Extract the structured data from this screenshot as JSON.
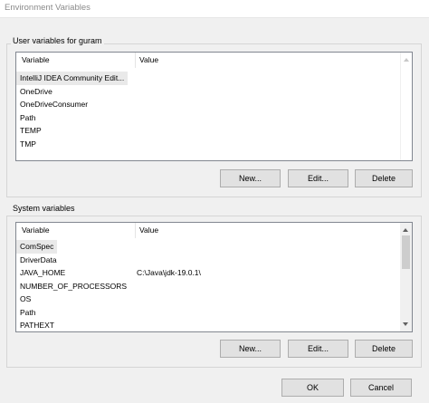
{
  "window": {
    "title": "Environment Variables"
  },
  "user_vars": {
    "group_label": "User variables for guram",
    "col_variable": "Variable",
    "col_value": "Value",
    "rows": [
      {
        "name": "IntelliJ IDEA Community Edit...",
        "value": ""
      },
      {
        "name": "OneDrive",
        "value": ""
      },
      {
        "name": "OneDriveConsumer",
        "value": ""
      },
      {
        "name": "Path",
        "value": ""
      },
      {
        "name": "TEMP",
        "value": ""
      },
      {
        "name": "TMP",
        "value": ""
      }
    ],
    "buttons": {
      "new": "New...",
      "edit": "Edit...",
      "delete": "Delete"
    }
  },
  "system_vars": {
    "group_label": "System variables",
    "col_variable": "Variable",
    "col_value": "Value",
    "rows": [
      {
        "name": "ComSpec",
        "value": ""
      },
      {
        "name": "DriverData",
        "value": ""
      },
      {
        "name": "JAVA_HOME",
        "value": "C:\\Java\\jdk-19.0.1\\"
      },
      {
        "name": "NUMBER_OF_PROCESSORS",
        "value": ""
      },
      {
        "name": "OS",
        "value": ""
      },
      {
        "name": "Path",
        "value": ""
      },
      {
        "name": "PATHEXT",
        "value": ""
      }
    ],
    "buttons": {
      "new": "New...",
      "edit": "Edit...",
      "delete": "Delete"
    }
  },
  "dialog_buttons": {
    "ok": "OK",
    "cancel": "Cancel"
  }
}
